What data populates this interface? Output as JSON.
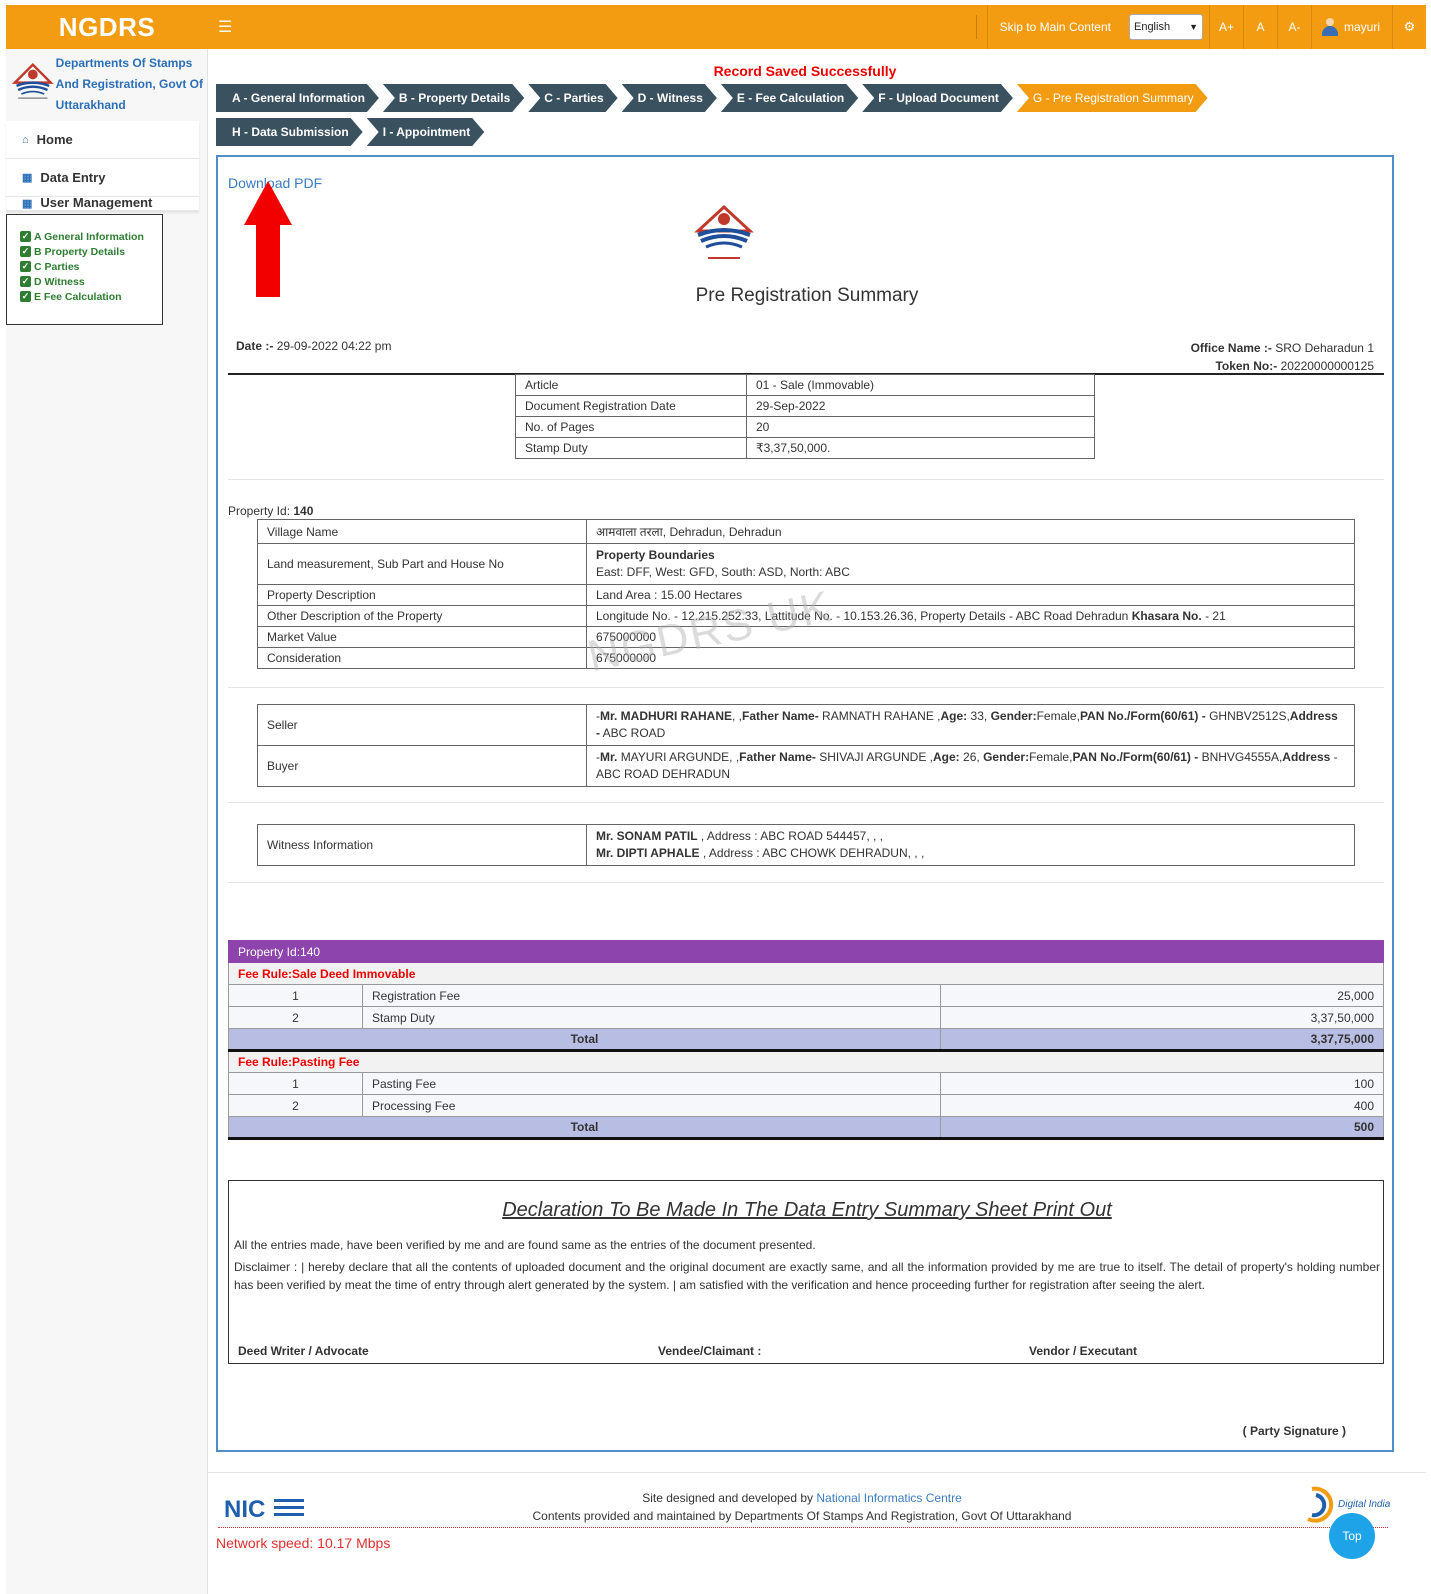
{
  "topbar": {
    "brand": "NGDRS",
    "menu_icon": "hamburger-icon",
    "skip_link": "Skip to Main Content",
    "language": "English",
    "font_increase": "A+",
    "font_normal": "A",
    "font_decrease": "A-",
    "user": "mayuri",
    "settings_icon": "gear-icon"
  },
  "sidebar": {
    "dept_lines": [
      "Departments Of Stamps",
      "And Registration, Govt Of",
      "Uttarakhand"
    ],
    "items": [
      {
        "label": "Home",
        "icon": "home-icon"
      },
      {
        "label": "Data Entry",
        "icon": "grid-icon"
      },
      {
        "label": "User Management",
        "icon": "grid-icon"
      }
    ],
    "checklist": [
      "A General Information",
      "B Property Details",
      "C Parties",
      "D Witness",
      "E Fee Calculation"
    ]
  },
  "status_message": "Record Saved Successfully",
  "steps_row1": [
    "A - General Information",
    "B - Property Details",
    "C - Parties",
    "D - Witness",
    "E - Fee Calculation",
    "F - Upload Document",
    "G - Pre Registration Summary"
  ],
  "steps_row2": [
    "H - Data Submission",
    "I - Appointment"
  ],
  "active_step": "G - Pre Registration Summary",
  "summary": {
    "download_pdf": "Download PDF",
    "title": "Pre Registration Summary",
    "date_label": "Date :-",
    "date_value": "29-09-2022 04:22 pm",
    "office_label": "Office Name :-",
    "office_value": "SRO Deharadun 1",
    "token_label": "Token No:-",
    "token_value": "20220000000125",
    "article_rows": [
      [
        "Article",
        "01 - Sale (Immovable)"
      ],
      [
        "Document Registration Date",
        "29-Sep-2022"
      ],
      [
        "No. of Pages",
        "20"
      ],
      [
        "Stamp Duty",
        "₹3,37,50,000."
      ]
    ],
    "property_id_label": "Property Id:",
    "property_id": "140",
    "property": {
      "village_label": "Village Name",
      "village_value": "आमवाला तरला, Dehradun, Dehradun",
      "land_label": "Land measurement, Sub Part and House No",
      "boundaries_title": "Property Boundaries",
      "boundaries_value": "East: DFF, West: GFD, South: ASD, North: ABC",
      "desc_label": "Property Description",
      "desc_value": "Land Area : 15.00 Hectares",
      "other_label": "Other Description of the Property",
      "other_value_pre": "Longitude No. - 12.215.252.33, Lattitude No. - 10.153.26.36, Property Details - ABC Road Dehradun",
      "other_khasara_label": "Khasara No.",
      "other_khasara_value": "- 21",
      "market_label": "Market Value",
      "market_value": "675000000",
      "consideration_label": "Consideration",
      "consideration_value": "675000000"
    },
    "watermark": "NGDRS UK",
    "parties": {
      "seller_label": "Seller",
      "seller_title": "Mr. MADHURI RAHANE",
      "seller_father_label": "Father Name-",
      "seller_father": "RAMNATH RAHANE",
      "seller_age": "33",
      "seller_gender": "Female",
      "seller_pan": "GHNBV2512S",
      "seller_address": "ABC ROAD",
      "buyer_label": "Buyer",
      "buyer_title": "Mr.",
      "buyer_name": "MAYURI ARGUNDE",
      "buyer_father": "SHIVAJI ARGUNDE",
      "buyer_age": "26",
      "buyer_gender": "Female",
      "buyer_pan": "BNHVG4555A",
      "buyer_address": "ABC ROAD DEHRADUN"
    },
    "witness": {
      "label": "Witness Information",
      "w1_name": "Mr. SONAM PATIL",
      "w1_rest": ", Address : ABC ROAD 544457, , ,",
      "w2_name": "Mr. DIPTI APHALE",
      "w2_rest": ", Address : ABC CHOWK DEHRADUN, , ,"
    }
  },
  "fees": {
    "header": "Property Id:140",
    "groups": [
      {
        "rule": "Fee Rule:Sale Deed Immovable",
        "rows": [
          [
            "1",
            "Registration Fee",
            "25,000"
          ],
          [
            "2",
            "Stamp Duty",
            "3,37,50,000"
          ]
        ],
        "total_label": "Total",
        "total": "3,37,75,000"
      },
      {
        "rule": "Fee Rule:Pasting Fee",
        "rows": [
          [
            "1",
            "Pasting Fee",
            "100"
          ],
          [
            "2",
            "Processing Fee",
            "400"
          ]
        ],
        "total_label": "Total",
        "total": "500"
      }
    ]
  },
  "declaration": {
    "title": "Declaration To Be Made In The Data Entry Summary Sheet Print Out",
    "p1": "All the entries made, have been verified by me and are found same as the entries of the document presented.",
    "p2": "Disclaimer : | hereby declare that all the contents of uploaded document and the original document are exactly same, and all the information provided by me are true to itself. The detail of property's holding number has been verified by meat the time of entry through alert generated by the system. | am satisfied with the verification and hence proceeding further for registration after seeing the alert.",
    "sig1": "Deed Writer / Advocate",
    "sig2": "Vendee/Claimant :",
    "sig3": "Vendor / Executant",
    "party_signature": "( Party Signature )"
  },
  "footer": {
    "designed_pre": "Site designed and developed by",
    "designed_link": "National Informatics Centre",
    "maintained": "Contents provided and maintained by Departments Of Stamps And Registration, Govt Of Uttarakhand",
    "network_speed": "Network speed:  10.17 Mbps",
    "top_button": "Top",
    "nic_logo_text": "NIC",
    "digital_india_text": "Digital India"
  },
  "colors": {
    "accent_orange": "#f39c12",
    "step_dark": "#3a5160",
    "fee_header_purple": "#8e44ad",
    "total_row": "#b8bde4",
    "link_blue": "#3c7cbf",
    "error_red": "#e00000"
  }
}
